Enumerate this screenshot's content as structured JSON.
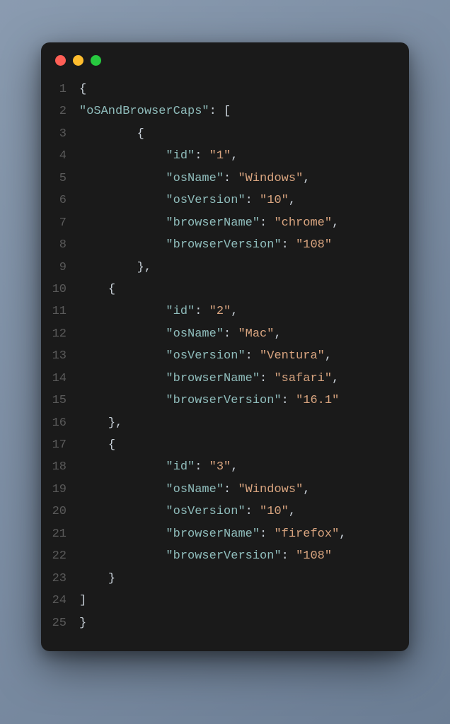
{
  "traffic_lights": {
    "red": "#ff5f56",
    "yellow": "#ffbd2e",
    "green": "#27c93f"
  },
  "line_numbers": [
    "1",
    "2",
    "3",
    "4",
    "5",
    "6",
    "7",
    "8",
    "9",
    "10",
    "11",
    "12",
    "13",
    "14",
    "15",
    "16",
    "17",
    "18",
    "19",
    "20",
    "21",
    "22",
    "23",
    "24",
    "25"
  ],
  "code": {
    "lines": [
      {
        "indent": 0,
        "tokens": [
          {
            "t": "punct",
            "v": "{"
          }
        ]
      },
      {
        "indent": 0,
        "tokens": [
          {
            "t": "key",
            "v": "\"oSAndBrowserCaps\""
          },
          {
            "t": "punct",
            "v": ": ["
          }
        ]
      },
      {
        "indent": 2,
        "tokens": [
          {
            "t": "punct",
            "v": "{"
          }
        ]
      },
      {
        "indent": 3,
        "tokens": [
          {
            "t": "key",
            "v": "\"id\""
          },
          {
            "t": "punct",
            "v": ": "
          },
          {
            "t": "string",
            "v": "\"1\""
          },
          {
            "t": "punct",
            "v": ","
          }
        ]
      },
      {
        "indent": 3,
        "tokens": [
          {
            "t": "key",
            "v": "\"osName\""
          },
          {
            "t": "punct",
            "v": ": "
          },
          {
            "t": "string",
            "v": "\"Windows\""
          },
          {
            "t": "punct",
            "v": ","
          }
        ]
      },
      {
        "indent": 3,
        "tokens": [
          {
            "t": "key",
            "v": "\"osVersion\""
          },
          {
            "t": "punct",
            "v": ": "
          },
          {
            "t": "string",
            "v": "\"10\""
          },
          {
            "t": "punct",
            "v": ","
          }
        ]
      },
      {
        "indent": 3,
        "tokens": [
          {
            "t": "key",
            "v": "\"browserName\""
          },
          {
            "t": "punct",
            "v": ": "
          },
          {
            "t": "string",
            "v": "\"chrome\""
          },
          {
            "t": "punct",
            "v": ","
          }
        ]
      },
      {
        "indent": 3,
        "tokens": [
          {
            "t": "key",
            "v": "\"browserVersion\""
          },
          {
            "t": "punct",
            "v": ": "
          },
          {
            "t": "string",
            "v": "\"108\""
          }
        ]
      },
      {
        "indent": 2,
        "tokens": [
          {
            "t": "punct",
            "v": "},"
          }
        ]
      },
      {
        "indent": 1,
        "tokens": [
          {
            "t": "punct",
            "v": "{"
          }
        ]
      },
      {
        "indent": 3,
        "tokens": [
          {
            "t": "key",
            "v": "\"id\""
          },
          {
            "t": "punct",
            "v": ": "
          },
          {
            "t": "string",
            "v": "\"2\""
          },
          {
            "t": "punct",
            "v": ","
          }
        ]
      },
      {
        "indent": 3,
        "tokens": [
          {
            "t": "key",
            "v": "\"osName\""
          },
          {
            "t": "punct",
            "v": ": "
          },
          {
            "t": "string",
            "v": "\"Mac\""
          },
          {
            "t": "punct",
            "v": ","
          }
        ]
      },
      {
        "indent": 3,
        "tokens": [
          {
            "t": "key",
            "v": "\"osVersion\""
          },
          {
            "t": "punct",
            "v": ": "
          },
          {
            "t": "string",
            "v": "\"Ventura\""
          },
          {
            "t": "punct",
            "v": ","
          }
        ]
      },
      {
        "indent": 3,
        "tokens": [
          {
            "t": "key",
            "v": "\"browserName\""
          },
          {
            "t": "punct",
            "v": ": "
          },
          {
            "t": "string",
            "v": "\"safari\""
          },
          {
            "t": "punct",
            "v": ","
          }
        ]
      },
      {
        "indent": 3,
        "tokens": [
          {
            "t": "key",
            "v": "\"browserVersion\""
          },
          {
            "t": "punct",
            "v": ": "
          },
          {
            "t": "string",
            "v": "\"16.1\""
          }
        ]
      },
      {
        "indent": 1,
        "tokens": [
          {
            "t": "punct",
            "v": "},"
          }
        ]
      },
      {
        "indent": 1,
        "tokens": [
          {
            "t": "punct",
            "v": "{"
          }
        ]
      },
      {
        "indent": 3,
        "tokens": [
          {
            "t": "key",
            "v": "\"id\""
          },
          {
            "t": "punct",
            "v": ": "
          },
          {
            "t": "string",
            "v": "\"3\""
          },
          {
            "t": "punct",
            "v": ","
          }
        ]
      },
      {
        "indent": 3,
        "tokens": [
          {
            "t": "key",
            "v": "\"osName\""
          },
          {
            "t": "punct",
            "v": ": "
          },
          {
            "t": "string",
            "v": "\"Windows\""
          },
          {
            "t": "punct",
            "v": ","
          }
        ]
      },
      {
        "indent": 3,
        "tokens": [
          {
            "t": "key",
            "v": "\"osVersion\""
          },
          {
            "t": "punct",
            "v": ": "
          },
          {
            "t": "string",
            "v": "\"10\""
          },
          {
            "t": "punct",
            "v": ","
          }
        ]
      },
      {
        "indent": 3,
        "tokens": [
          {
            "t": "key",
            "v": "\"browserName\""
          },
          {
            "t": "punct",
            "v": ": "
          },
          {
            "t": "string",
            "v": "\"firefox\""
          },
          {
            "t": "punct",
            "v": ","
          }
        ]
      },
      {
        "indent": 3,
        "tokens": [
          {
            "t": "key",
            "v": "\"browserVersion\""
          },
          {
            "t": "punct",
            "v": ": "
          },
          {
            "t": "string",
            "v": "\"108\""
          }
        ]
      },
      {
        "indent": 1,
        "tokens": [
          {
            "t": "punct",
            "v": "}"
          }
        ]
      },
      {
        "indent": 0,
        "tokens": [
          {
            "t": "punct",
            "v": "]"
          }
        ]
      },
      {
        "indent": 0,
        "tokens": [
          {
            "t": "punct",
            "v": "}"
          }
        ]
      }
    ]
  },
  "json_content": {
    "oSAndBrowserCaps": [
      {
        "id": "1",
        "osName": "Windows",
        "osVersion": "10",
        "browserName": "chrome",
        "browserVersion": "108"
      },
      {
        "id": "2",
        "osName": "Mac",
        "osVersion": "Ventura",
        "browserName": "safari",
        "browserVersion": "16.1"
      },
      {
        "id": "3",
        "osName": "Windows",
        "osVersion": "10",
        "browserName": "firefox",
        "browserVersion": "108"
      }
    ]
  }
}
